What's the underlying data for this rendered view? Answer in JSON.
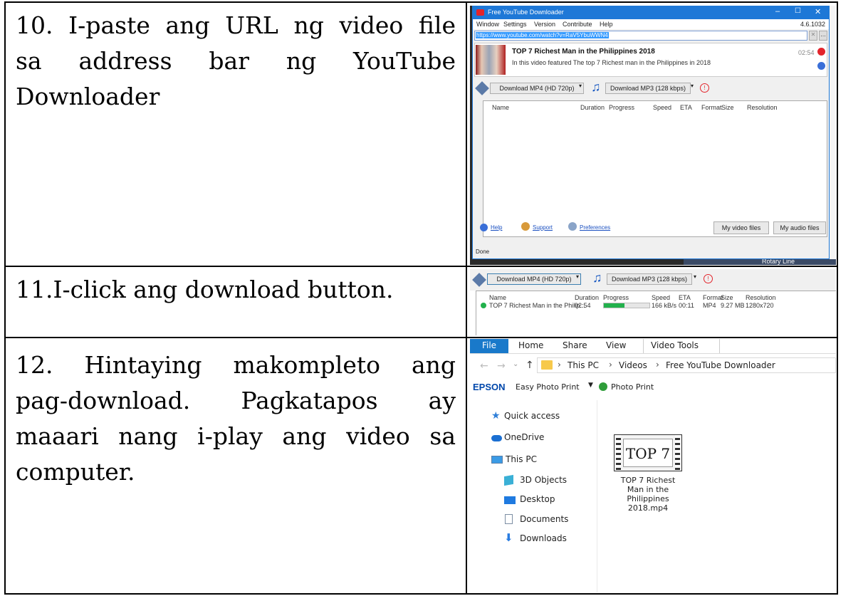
{
  "steps": [
    {
      "lines": [
        "10. I-paste ang URL ng video file",
        "sa  address  bar  ng  YouTube",
        "Downloader"
      ]
    },
    {
      "lines": [
        "11.I-click ang download button."
      ]
    },
    {
      "lines": [
        "12.  Hintaying  makompleto  ang",
        "pag-download.  Pagkatapos  ay",
        "maaari nang i-play ang video sa",
        "computer."
      ]
    }
  ],
  "downloader": {
    "title": "Free YouTube Downloader",
    "menu": [
      "Window",
      "Settings",
      "Version",
      "Contribute",
      "Help"
    ],
    "version": "4.6.1032",
    "url": "https://www.youtube.com/watch?v=RaV5YbuWWN4",
    "video_title": "TOP 7 Richest Man in the Philippines 2018",
    "video_desc": "In this video featured The top 7 Richest man in the Philippines in 2018",
    "duration": "02:54",
    "download_mp4": "Download MP4 (HD 720p)",
    "download_mp3": "Download MP3 (128 kbps)",
    "columns": [
      "Name",
      "Duration",
      "Progress",
      "Speed",
      "ETA",
      "Format",
      "Size",
      "Resolution"
    ],
    "footer_links": [
      "Help",
      "Support",
      "Preferences"
    ],
    "my_video_files": "My video files",
    "my_audio_files": "My audio files",
    "status": "Done",
    "bg_text": "Rotary Line"
  },
  "download_row": {
    "name": "TOP 7 Richest Man in the Philip...",
    "duration": "02:54",
    "progress_fraction": 0.46,
    "speed": "166 kB/s",
    "eta": "00:11",
    "format": "MP4",
    "size": "9.27 MB",
    "resolution": "1280x720"
  },
  "explorer": {
    "ribbon_tabs": [
      "File",
      "Home",
      "Share",
      "View",
      "Video Tools"
    ],
    "breadcrumb": [
      "This PC",
      "Videos",
      "Free YouTube Downloader"
    ],
    "epson_brand": "EPSON",
    "epson_app": "Easy Photo Print",
    "photo_print": "Photo Print",
    "nav": [
      "Quick access",
      "OneDrive",
      "This PC",
      "3D Objects",
      "Desktop",
      "Documents",
      "Downloads"
    ],
    "thumb_text": "TOP 7",
    "file_name_lines": [
      "TOP 7 Richest",
      "Man in the",
      "Philippines",
      "2018.mp4"
    ]
  },
  "colors": {
    "titlebar": "#1e78d7",
    "file_tab": "#1979ca",
    "progress": "#22b14c",
    "epson": "#0047ab",
    "red_icon": "#e3242b"
  }
}
